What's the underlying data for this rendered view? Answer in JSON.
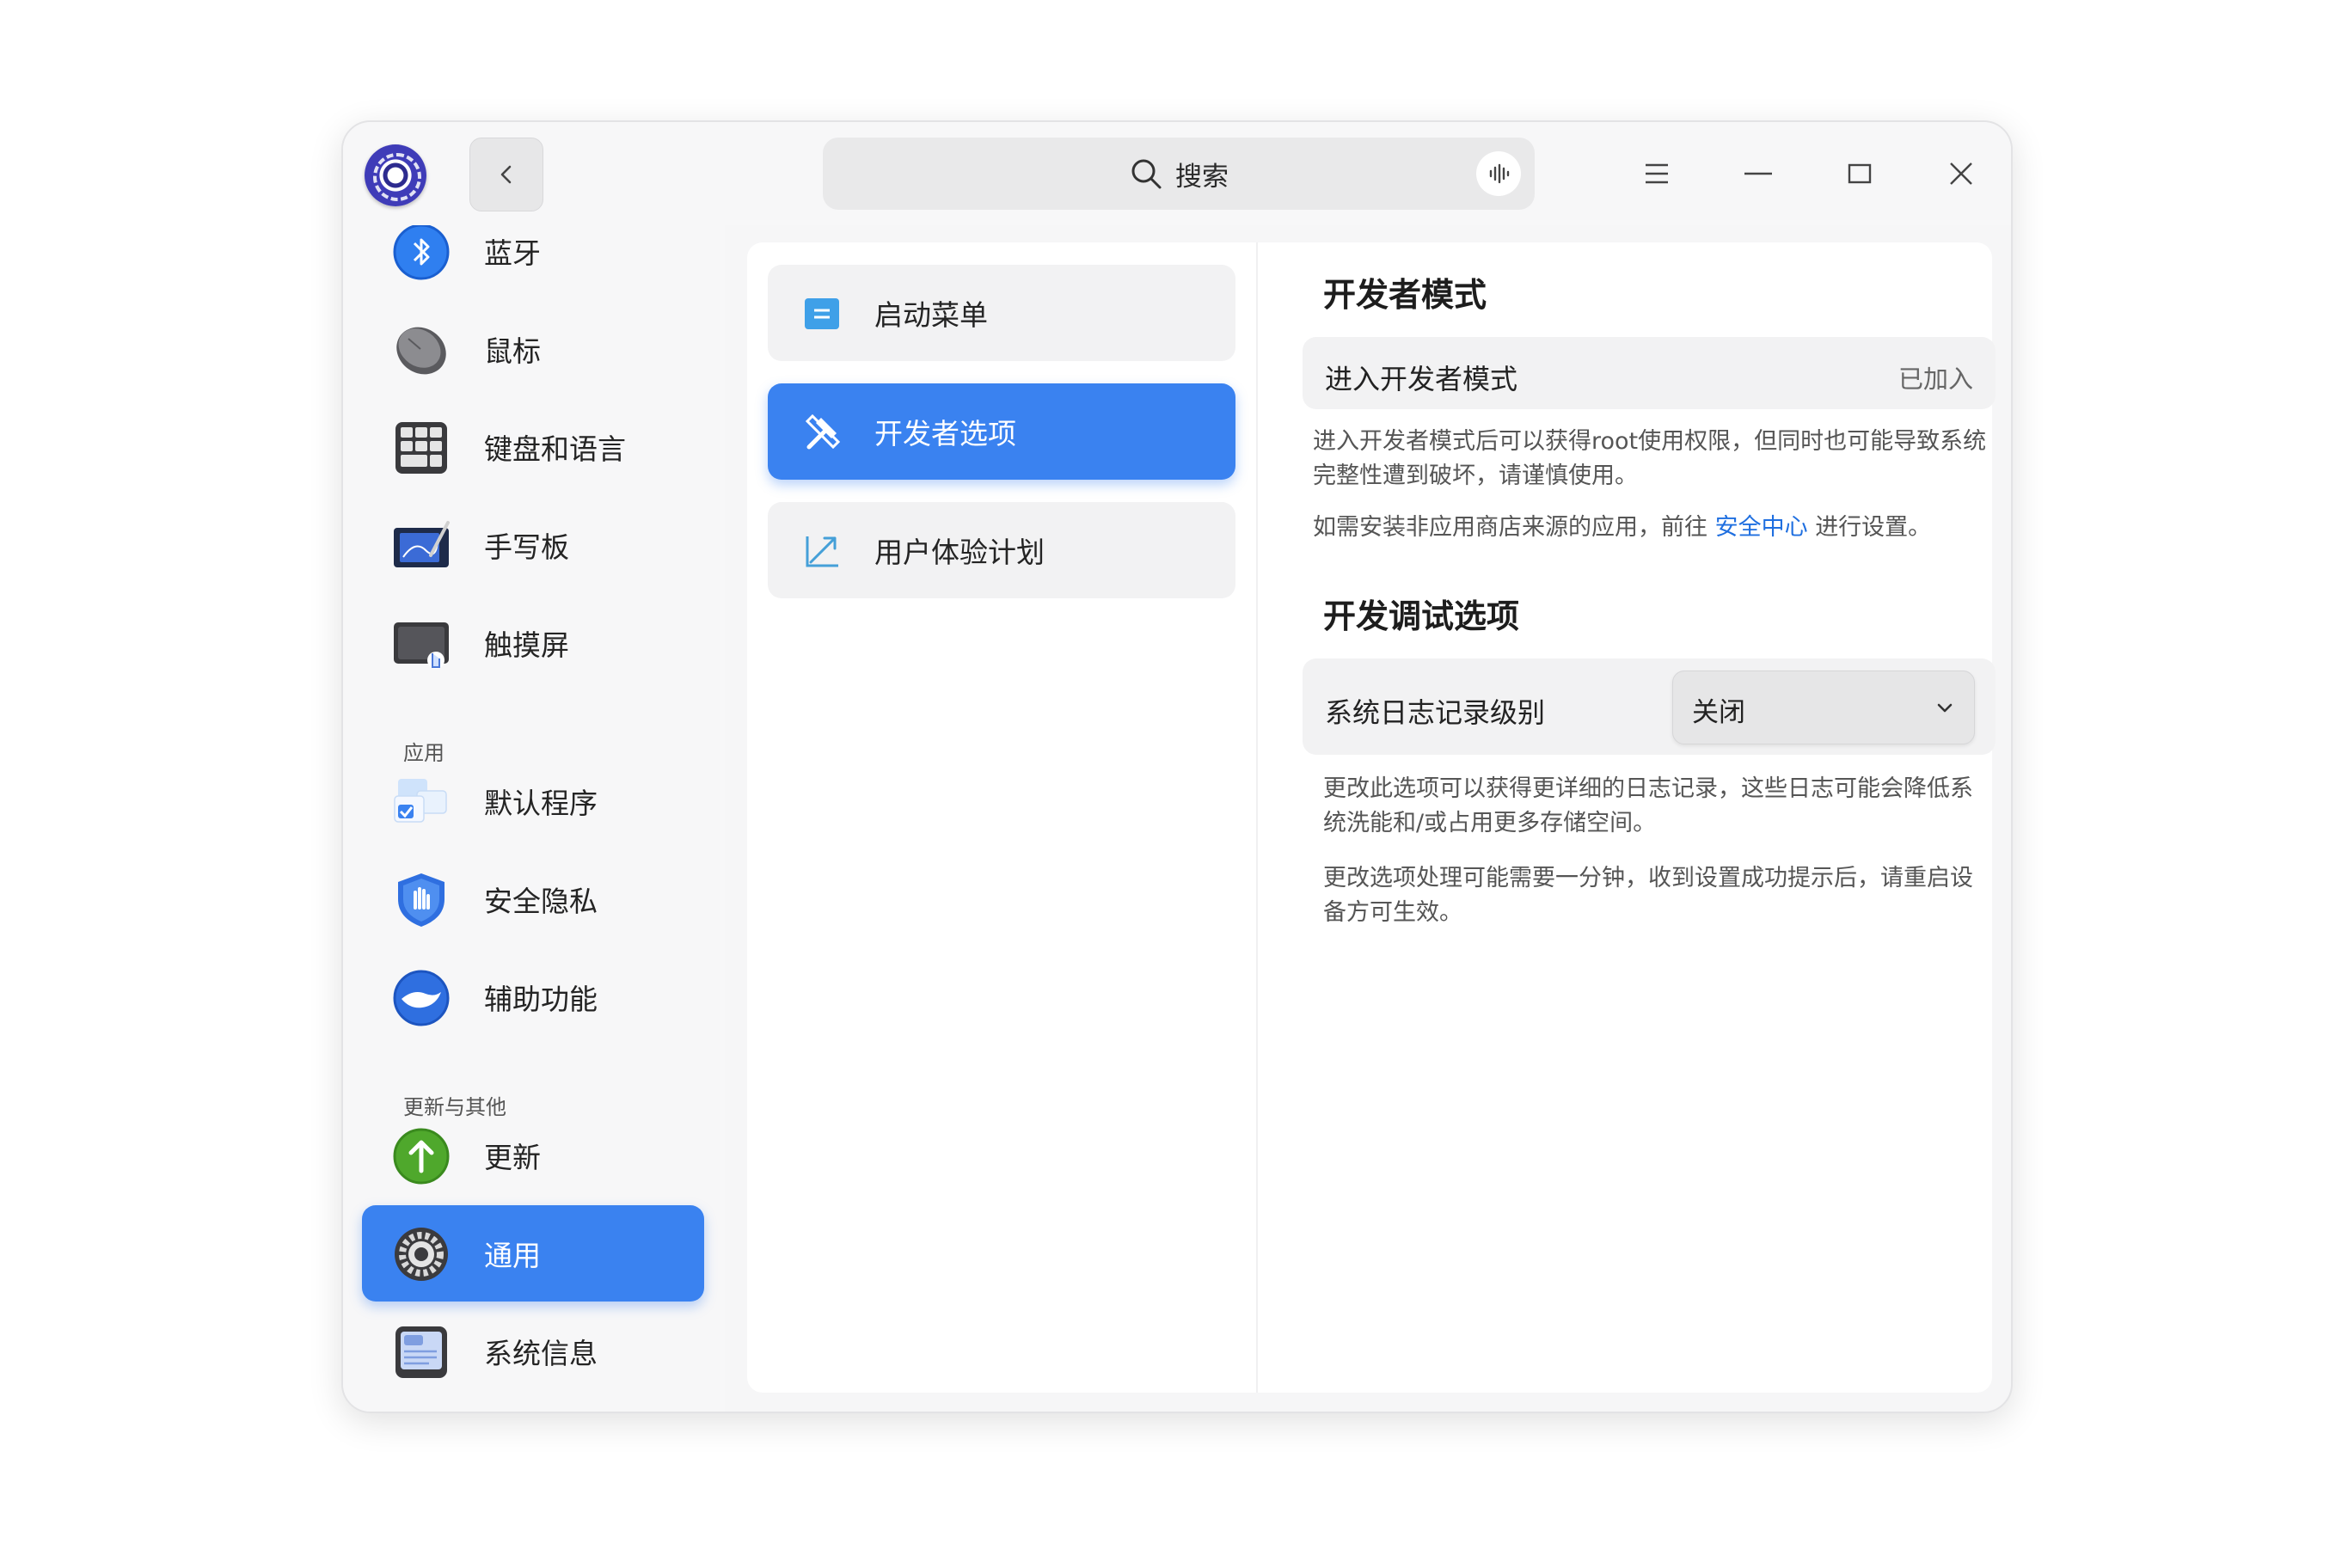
{
  "titlebar": {
    "search_placeholder": "搜索",
    "icons": [
      "app-logo",
      "back-icon",
      "search-icon",
      "voice-icon",
      "menu-icon",
      "minimize-icon",
      "maximize-icon",
      "close-icon"
    ]
  },
  "sidebar": {
    "items": [
      {
        "label": "蓝牙",
        "icon": "bluetooth-icon"
      },
      {
        "label": "鼠标",
        "icon": "mouse-icon"
      },
      {
        "label": "键盘和语言",
        "icon": "keyboard-icon"
      },
      {
        "label": "手写板",
        "icon": "tablet-icon"
      },
      {
        "label": "触摸屏",
        "icon": "touchscreen-icon"
      }
    ],
    "group_apps": "应用",
    "apps": [
      {
        "label": "默认程序",
        "icon": "default-apps-icon"
      },
      {
        "label": "安全隐私",
        "icon": "security-shield-icon"
      },
      {
        "label": "辅助功能",
        "icon": "accessibility-icon"
      }
    ],
    "group_updates": "更新与其他",
    "others": [
      {
        "label": "更新",
        "icon": "update-arrow-icon"
      },
      {
        "label": "通用",
        "icon": "general-gear-icon",
        "active": true
      },
      {
        "label": "系统信息",
        "icon": "system-info-icon"
      }
    ]
  },
  "middle": {
    "items": [
      {
        "label": "启动菜单",
        "icon": "boot-menu-icon"
      },
      {
        "label": "开发者选项",
        "icon": "developer-tools-icon",
        "active": true
      },
      {
        "label": "用户体验计划",
        "icon": "user-experience-icon"
      }
    ]
  },
  "content": {
    "dev_mode_title": "开发者模式",
    "dev_mode_row_label": "进入开发者模式",
    "dev_mode_row_value": "已加入",
    "dev_mode_desc": "进入开发者模式后可以获得root使用权限，但同时也可能导致系统完整性遭到破坏，请谨慎使用。",
    "install_desc_before": "如需安装非应用商店来源的应用，前往",
    "install_desc_link": "安全中心",
    "install_desc_after": "进行设置。",
    "debug_title": "开发调试选项",
    "log_level_label": "系统日志记录级别",
    "log_level_value": "关闭",
    "log_desc_1": "更改此选项可以获得更详细的日志记录，这些日志可能会降低系统洗能和/或占用更多存储空间。",
    "log_desc_2": "更改选项处理可能需要一分钟，收到设置成功提示后，请重启设备方可生效。"
  },
  "colors": {
    "accent": "#3a82f0",
    "link": "#1f6fe0"
  }
}
